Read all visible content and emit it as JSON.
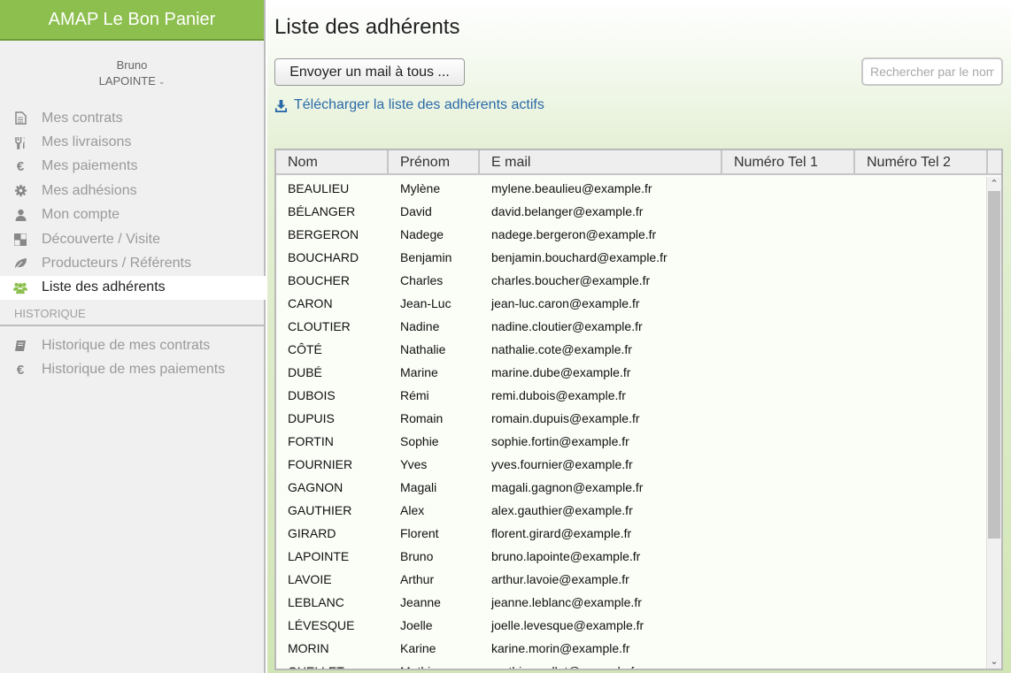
{
  "app": {
    "title": "AMAP Le Bon Panier"
  },
  "user": {
    "first_name": "Bruno",
    "last_name": "LAPOINTE"
  },
  "menu": [
    {
      "label": "Mes contrats",
      "icon": "file-icon"
    },
    {
      "label": "Mes livraisons",
      "icon": "cutlery-icon"
    },
    {
      "label": "Mes paiements",
      "icon": "euro-icon"
    },
    {
      "label": "Mes adhésions",
      "icon": "gear-icon"
    },
    {
      "label": "Mon compte",
      "icon": "user-icon"
    },
    {
      "label": "Découverte / Visite",
      "icon": "checker-icon"
    },
    {
      "label": "Producteurs / Référents",
      "icon": "leaf-icon"
    },
    {
      "label": "Liste des adhérents",
      "icon": "users-icon",
      "active": true
    }
  ],
  "history_section": {
    "label": "HISTORIQUE"
  },
  "history_menu": [
    {
      "label": "Historique de mes contrats",
      "icon": "book-icon"
    },
    {
      "label": "Historique de mes paiements",
      "icon": "euro-icon"
    }
  ],
  "main": {
    "title": "Liste des adhérents",
    "mail_button": "Envoyer un mail à tous ...",
    "search_placeholder": "Rechercher par le nom",
    "search_value": "",
    "download_link": "Télécharger la liste des adhérents actifs"
  },
  "table": {
    "columns": [
      "Nom",
      "Prénom",
      "E mail",
      "Numéro Tel 1",
      "Numéro Tel 2"
    ],
    "rows": [
      [
        "BEAULIEU",
        "Mylène",
        "mylene.beaulieu@example.fr",
        "",
        ""
      ],
      [
        "BÉLANGER",
        "David",
        "david.belanger@example.fr",
        "",
        ""
      ],
      [
        "BERGERON",
        "Nadege",
        "nadege.bergeron@example.fr",
        "",
        ""
      ],
      [
        "BOUCHARD",
        "Benjamin",
        "benjamin.bouchard@example.fr",
        "",
        ""
      ],
      [
        "BOUCHER",
        "Charles",
        "charles.boucher@example.fr",
        "",
        ""
      ],
      [
        "CARON",
        "Jean-Luc",
        "jean-luc.caron@example.fr",
        "",
        ""
      ],
      [
        "CLOUTIER",
        "Nadine",
        "nadine.cloutier@example.fr",
        "",
        ""
      ],
      [
        "CÔTÉ",
        "Nathalie",
        "nathalie.cote@example.fr",
        "",
        ""
      ],
      [
        "DUBÉ",
        "Marine",
        "marine.dube@example.fr",
        "",
        ""
      ],
      [
        "DUBOIS",
        "Rémi",
        "remi.dubois@example.fr",
        "",
        ""
      ],
      [
        "DUPUIS",
        "Romain",
        "romain.dupuis@example.fr",
        "",
        ""
      ],
      [
        "FORTIN",
        "Sophie",
        "sophie.fortin@example.fr",
        "",
        ""
      ],
      [
        "FOURNIER",
        "Yves",
        "yves.fournier@example.fr",
        "",
        ""
      ],
      [
        "GAGNON",
        "Magali",
        "magali.gagnon@example.fr",
        "",
        ""
      ],
      [
        "GAUTHIER",
        "Alex",
        "alex.gauthier@example.fr",
        "",
        ""
      ],
      [
        "GIRARD",
        "Florent",
        "florent.girard@example.fr",
        "",
        ""
      ],
      [
        "LAPOINTE",
        "Bruno",
        "bruno.lapointe@example.fr",
        "",
        ""
      ],
      [
        "LAVOIE",
        "Arthur",
        "arthur.lavoie@example.fr",
        "",
        ""
      ],
      [
        "LEBLANC",
        "Jeanne",
        "jeanne.leblanc@example.fr",
        "",
        ""
      ],
      [
        "LÉVESQUE",
        "Joelle",
        "joelle.levesque@example.fr",
        "",
        ""
      ],
      [
        "MORIN",
        "Karine",
        "karine.morin@example.fr",
        "",
        ""
      ],
      [
        "OUELLET",
        "Mathis",
        "mathis.ouellet@example.fr",
        "",
        ""
      ]
    ]
  },
  "colors": {
    "brand": "#8dbf4e",
    "link": "#2a6aa8"
  }
}
